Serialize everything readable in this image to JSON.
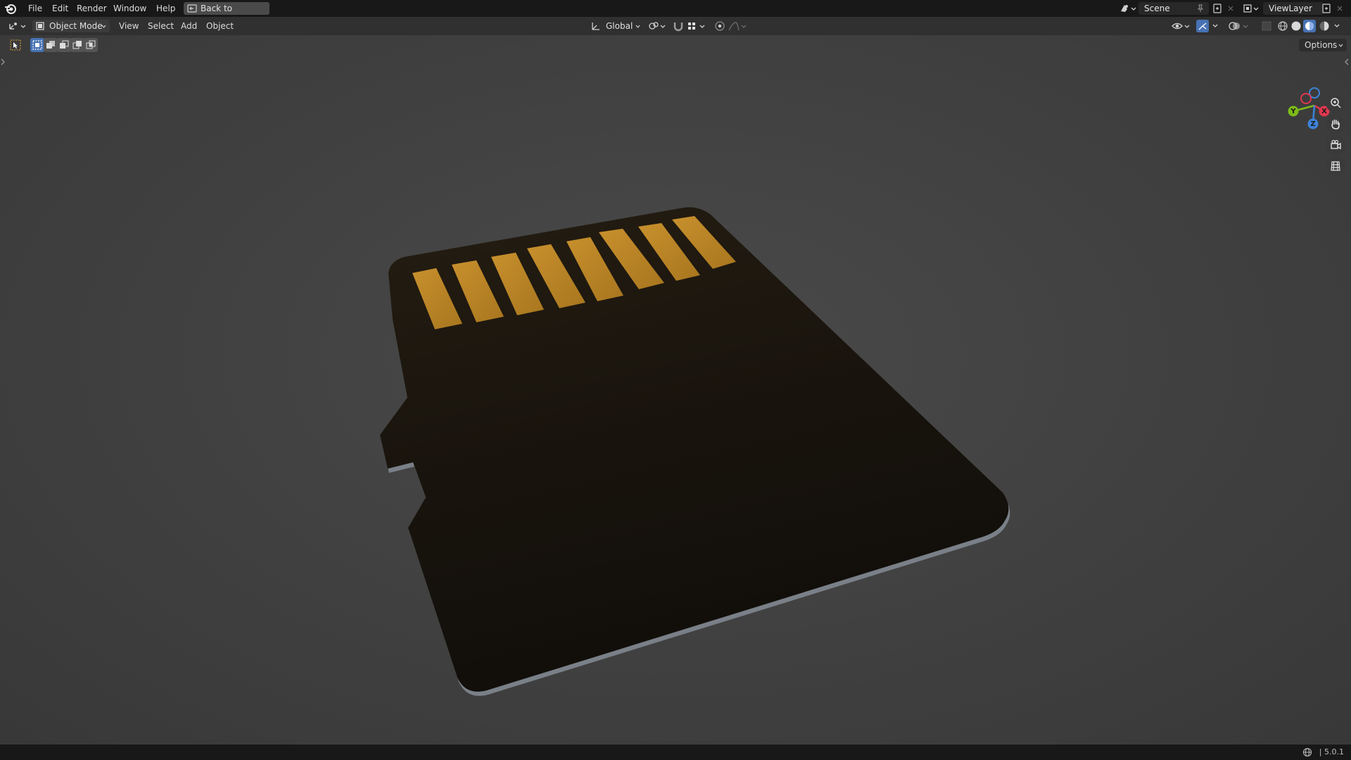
{
  "topbar": {
    "menus": [
      "File",
      "Edit",
      "Render",
      "Window",
      "Help"
    ],
    "back_button": "Back to Previous",
    "scene_name": "Scene",
    "view_layer": "ViewLayer"
  },
  "header": {
    "mode": "Object Mode",
    "menus": [
      "View",
      "Select",
      "Add",
      "Object"
    ],
    "orientation": "Global",
    "options_label": "Options"
  },
  "gizmo": {
    "x_label": "X",
    "y_label": "Y",
    "z_label": "Z"
  },
  "statusbar": {
    "version": "| 5.0.1"
  },
  "icons": {
    "logo": "blender-logo-icon",
    "back": "back-arrow-icon",
    "editor_type": "3d-viewport-icon",
    "mode": "object-mode-icon",
    "transform_orientation": "orientation-icon",
    "pivot": "pivot-point-icon",
    "snap": "magnet-icon",
    "snap_target": "snap-grid-icon",
    "proportional": "proportional-edit-icon",
    "falloff": "falloff-curve-icon",
    "visibility": "eye-icon",
    "gizmo_toggle": "gizmo-icon",
    "overlays": "overlays-icon",
    "xray": "xray-icon",
    "shading": [
      "wireframe-shading-icon",
      "solid-shading-icon",
      "material-shading-icon",
      "rendered-shading-icon"
    ],
    "zoom": "zoom-icon",
    "pan": "hand-icon",
    "camera": "camera-icon",
    "grid": "ortho-grid-icon",
    "language": "globe-icon"
  },
  "colors": {
    "accent": "#4772b3",
    "contact": "#c28a2a",
    "card": "#1a150f",
    "axis_x": "#e0384f",
    "axis_y": "#7cbb1a",
    "axis_z": "#3d82d9"
  }
}
